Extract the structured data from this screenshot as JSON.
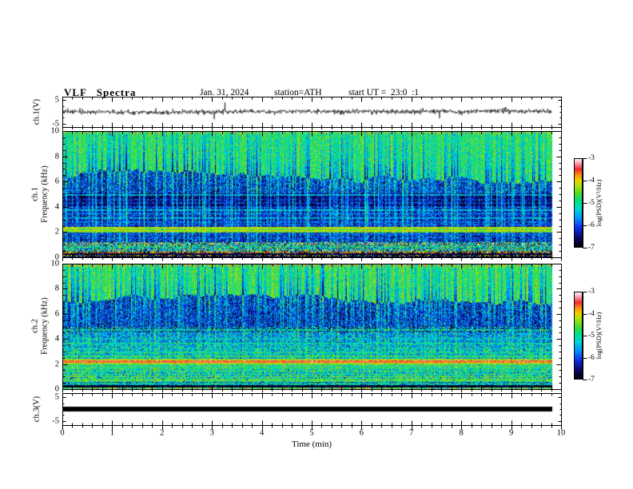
{
  "header": {
    "title": "VLF Spectra",
    "date": "Jan. 31, 2024",
    "station": "station=ATH",
    "start_ut": "start UT =  23:0  :1"
  },
  "x_axis": {
    "label": "Time (min)",
    "range": [
      0,
      10
    ],
    "ticks": [
      0,
      1,
      2,
      3,
      4,
      5,
      6,
      7,
      8,
      9,
      10
    ],
    "minor_step": 0.2,
    "data_end_min": 9.82
  },
  "panels": {
    "wave1": {
      "ylabel": "ch.1(V)",
      "yrange": [
        -6.45,
        6.45
      ],
      "yticks": [
        5,
        -5
      ],
      "yminors": [
        2.5,
        0,
        -2.5
      ]
    },
    "spec1": {
      "ylabel_lines": [
        "ch.1",
        "Frequency (kHz)"
      ],
      "yrange": [
        0,
        10
      ],
      "yticks": [
        10,
        8,
        6,
        4,
        2,
        0
      ],
      "yminor_step": 0.5
    },
    "spec2": {
      "ylabel_lines": [
        "ch.2",
        "Frequency (kHz)"
      ],
      "yrange": [
        0,
        10
      ],
      "yticks": [
        10,
        8,
        6,
        4,
        2,
        0
      ],
      "yminor_step": 0.5
    },
    "wave3": {
      "ylabel": "ch.3(V)",
      "yrange": [
        -6.7,
        6.7
      ],
      "yticks": [
        5,
        -5
      ],
      "yminors": [
        2.5,
        0,
        -2.5
      ]
    }
  },
  "colorbar": {
    "label": "log(PSD)(V²/Hz)",
    "range": [
      -7,
      -3
    ],
    "ticks": [
      -3,
      -4,
      -5,
      -6,
      -7
    ]
  },
  "colors": {
    "foreground": "#000000",
    "background": "#ffffff"
  },
  "colormap": [
    [
      0.0,
      [
        0,
        0,
        0
      ]
    ],
    [
      0.1,
      [
        8,
        8,
        96
      ]
    ],
    [
      0.22,
      [
        16,
        48,
        235
      ]
    ],
    [
      0.33,
      [
        0,
        150,
        255
      ]
    ],
    [
      0.43,
      [
        0,
        215,
        215
      ]
    ],
    [
      0.52,
      [
        0,
        225,
        135
      ]
    ],
    [
      0.6,
      [
        70,
        220,
        45
      ]
    ],
    [
      0.68,
      [
        160,
        225,
        20
      ]
    ],
    [
      0.75,
      [
        235,
        215,
        0
      ]
    ],
    [
      0.82,
      [
        255,
        140,
        20
      ]
    ],
    [
      0.88,
      [
        242,
        40,
        45
      ]
    ],
    [
      0.94,
      [
        250,
        150,
        165
      ]
    ],
    [
      1.0,
      [
        255,
        255,
        255
      ]
    ]
  ],
  "chart_data": [
    {
      "id": "ch1_wave",
      "type": "line",
      "title": "ch.1 voltage trace",
      "units": "V",
      "mean": 0,
      "noise_sigma": 0.5,
      "spike_rate": 0.0065,
      "spike_amp_v": [
        1.0,
        4.4
      ],
      "seed": 3
    },
    {
      "id": "ch1_spec",
      "type": "heatmap",
      "title": "ch.1 VLF spectrogram",
      "f_range_khz": [
        0,
        10
      ],
      "psd_log_range": [
        -7,
        -3
      ],
      "seed": 7,
      "streaks": {
        "density": 0.45,
        "power": 1.3,
        "spread": 0.45
      },
      "flares": {
        "density": 0.02,
        "spread": 0.5
      },
      "bands": [
        {
          "f": [
            9.72,
            10
          ],
          "psd": -4.55,
          "noise": 0.55,
          "streak": -0.5,
          "dots": [
            0.06,
            -3.6
          ]
        },
        {
          "f": [
            5.05,
            9.72
          ],
          "type": "transition",
          "boundary": 6.4,
          "bvar": 0.55,
          "green_psd": -4.72,
          "green_noise": 0.33,
          "blue_psd": -6.15,
          "blue_noise": 0.5,
          "dark_amp": [
            0.55,
            1.7,
            0.55
          ],
          "bright_amp": [
            0.35,
            1.25,
            0.5
          ],
          "flare_amp": 0.6
        },
        {
          "f": [
            4.05,
            5.05
          ],
          "psd": -6.7,
          "noise": 0.3,
          "streak": 1.2
        },
        {
          "f": [
            3.0,
            4.05
          ],
          "psd": -6.3,
          "noise": 0.4,
          "streak": 1.0
        },
        {
          "f": [
            2.42,
            3.0
          ],
          "psd": -6.35,
          "noise": 0.4,
          "streak": 0.9
        },
        {
          "f": [
            1.98,
            2.42
          ],
          "psd": -4.55,
          "noise": 0.35,
          "streak": 0.2
        },
        {
          "f": [
            1.22,
            1.98
          ],
          "psd": -6.3,
          "noise": 0.45,
          "streak": 0.8
        },
        {
          "f": [
            0.95,
            1.22
          ],
          "psd": -5.1,
          "noise": 1.25,
          "streak": 0
        },
        {
          "f": [
            0.62,
            0.95
          ],
          "psd": -5.45,
          "noise": 0.8,
          "streak": 0.3
        },
        {
          "f": [
            0.45,
            0.62
          ],
          "psd": -5.3,
          "noise": 1.1,
          "streak": 0.3
        },
        {
          "f": [
            0,
            0.45
          ],
          "psd": -6.8,
          "noise": 0.25,
          "streak": 0,
          "dots": [
            0.04,
            -5.8
          ]
        }
      ],
      "hlines": [
        [
          4.95,
          -5.4,
          0.8
        ],
        [
          4.55,
          -6.0,
          0.5
        ],
        [
          4.3,
          -5.9,
          0.5
        ],
        [
          3.95,
          -5.9,
          0.5
        ],
        [
          3.72,
          -5.35,
          0.8
        ],
        [
          3.45,
          -5.55,
          0.7
        ],
        [
          3.12,
          -5.45,
          0.7
        ],
        [
          2.8,
          -5.8,
          0.6
        ],
        [
          2.58,
          -5.95,
          0.5
        ],
        [
          2.32,
          -4.25,
          0.9
        ],
        [
          2.08,
          -4.35,
          0.9
        ],
        [
          1.82,
          -5.95,
          0.5
        ],
        [
          1.5,
          -6.05,
          0.4
        ],
        [
          0.8,
          -5.0,
          0.5
        ],
        [
          0.37,
          -3.8,
          0.55
        ],
        [
          0.12,
          -4.0,
          0.3
        ]
      ]
    },
    {
      "id": "ch2_spec",
      "type": "heatmap",
      "title": "ch.2 VLF spectrogram",
      "f_range_khz": [
        0,
        10
      ],
      "psd_log_range": [
        -7,
        -3
      ],
      "seed": 13,
      "streaks": {
        "density": 0.45,
        "power": 1.3,
        "spread": 0.45
      },
      "flares": {
        "density": 0.03,
        "spread": 0.5
      },
      "bands": [
        {
          "f": [
            9.75,
            10
          ],
          "psd": -4.5,
          "noise": 0.6,
          "streak": -0.4,
          "dots": [
            0.06,
            -3.5
          ]
        },
        {
          "f": [
            5.0,
            9.75
          ],
          "type": "transition",
          "boundary": 7.05,
          "bvar": 0.5,
          "green_psd": -4.68,
          "green_noise": 0.33,
          "blue_psd": -6.2,
          "blue_noise": 0.5,
          "dark_amp": [
            0.55,
            1.7,
            0.55
          ],
          "bright_amp": [
            0.35,
            1.3,
            0.5
          ],
          "flare_amp": 0.6
        },
        {
          "f": [
            4.5,
            5.0
          ],
          "psd": -5.95,
          "noise": 0.75,
          "streak": 0.4
        },
        {
          "f": [
            3.5,
            4.5
          ],
          "psd": -5.65,
          "noise": 0.5,
          "streak": 0.5
        },
        {
          "f": [
            2.45,
            3.5
          ],
          "psd": -5.45,
          "noise": 0.5,
          "streak": 0.4
        },
        {
          "f": [
            2.28,
            2.45
          ],
          "psd": -4.35,
          "noise": 0.3,
          "streak": 0.1
        },
        {
          "f": [
            2.12,
            2.28
          ],
          "psd": -3.55,
          "noise": 0.2,
          "streak": 0
        },
        {
          "f": [
            1.98,
            2.12
          ],
          "psd": -4.25,
          "noise": 0.3,
          "streak": 0
        },
        {
          "f": [
            1.62,
            1.98
          ],
          "psd": -4.95,
          "noise": 0.45,
          "streak": 0.2
        },
        {
          "f": [
            1.08,
            1.62
          ],
          "psd": -5.3,
          "noise": 0.55,
          "streak": 0.3
        },
        {
          "f": [
            0.58,
            1.08
          ],
          "psd": -5.2,
          "noise": 0.6,
          "streak": 0.2
        },
        {
          "f": [
            0.32,
            0.58
          ],
          "psd": -5.9,
          "noise": 0.5,
          "streak": 0.2
        },
        {
          "f": [
            0.1,
            0.32
          ],
          "psd": -6.85,
          "noise": 0.2,
          "streak": 0,
          "dots": [
            0.03,
            -5.9
          ]
        },
        {
          "f": [
            0,
            0.1
          ],
          "psd": -4.6,
          "noise": 0.7,
          "streak": 0
        }
      ],
      "hlines": [
        [
          4.72,
          -5.05,
          0.75
        ],
        [
          4.02,
          -5.3,
          0.7
        ],
        [
          3.62,
          -5.05,
          0.8
        ],
        [
          3.22,
          -5.05,
          0.7
        ],
        [
          2.92,
          -4.95,
          0.75
        ],
        [
          2.62,
          -4.75,
          0.8
        ],
        [
          1.78,
          -5.9,
          0.6
        ],
        [
          1.48,
          -4.9,
          0.7
        ],
        [
          1.18,
          -4.85,
          0.7
        ],
        [
          0.98,
          -4.6,
          0.8
        ],
        [
          0.78,
          -4.65,
          0.8
        ],
        [
          0.62,
          -4.7,
          0.7
        ],
        [
          0.48,
          -4.8,
          0.7
        ],
        [
          0.36,
          -5.0,
          0.6
        ]
      ]
    },
    {
      "id": "ch3_wave",
      "type": "line",
      "title": "ch.3 voltage trace (flat)",
      "units": "V",
      "value": 0,
      "bar_halfwidth_v": 1.0,
      "seed": 5
    }
  ]
}
